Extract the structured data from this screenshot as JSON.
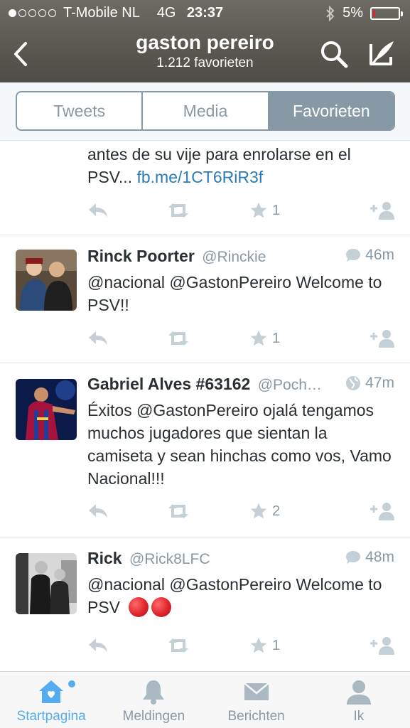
{
  "status_bar": {
    "carrier": "T-Mobile NL",
    "network": "4G",
    "time": "23:37",
    "battery": "5%",
    "battery_level": 0.05,
    "signal_bars": 1
  },
  "nav": {
    "title": "gaston pereiro",
    "subtitle": "1.212 favorieten"
  },
  "tabs": [
    {
      "label": "Tweets",
      "active": false
    },
    {
      "label": "Media",
      "active": false
    },
    {
      "label": "Favorieten",
      "active": true
    }
  ],
  "tweets": [
    {
      "text": "antes de su vije para enrolarse en el PSV...",
      "link": "fb.me/1CT6RiR3f",
      "favorites": "1"
    },
    {
      "name": "Rinck Poorter",
      "handle": "@Rinckie",
      "time": "46m",
      "meta_icon": "speech-bubble-icon",
      "text": "@nacional @GastonPereiro Welcome to PSV!!",
      "favorites": "1"
    },
    {
      "name": "Gabriel Alves #63162",
      "handle": "@Poch…",
      "time": "47m",
      "meta_icon": "globe-icon",
      "text": "Éxitos @GastonPereiro ojalá tengamos muchos jugadores que sientan la camiseta y sean hinchas como vos, Vamo Nacional!!!",
      "favorites": "2"
    },
    {
      "name": "Rick",
      "handle": "@Rick8LFC",
      "time": "48m",
      "meta_icon": "speech-bubble-icon",
      "text": "@nacional @GastonPereiro Welcome to PSV",
      "emoji": "red-circle-emoji",
      "favorites": "1"
    }
  ],
  "tabbar": [
    {
      "label": "Startpagina",
      "icon": "home-icon",
      "active": true
    },
    {
      "label": "Meldingen",
      "icon": "bell-icon",
      "active": false
    },
    {
      "label": "Berichten",
      "icon": "envelope-icon",
      "active": false
    },
    {
      "label": "Ik",
      "icon": "person-icon",
      "active": false
    }
  ],
  "colors": {
    "accent": "#55acee",
    "link": "#2b7bb9",
    "muted": "#8899a6",
    "text": "#292f33",
    "battery_low": "#e0242c"
  }
}
